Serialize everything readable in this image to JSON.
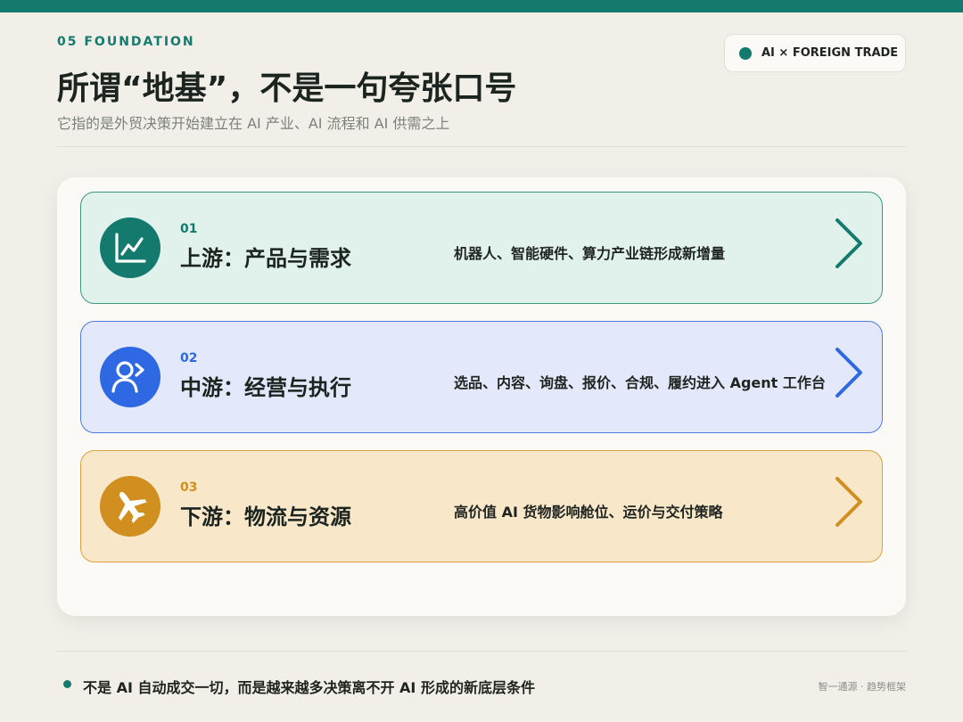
{
  "header": {
    "eyebrow": "05 FOUNDATION",
    "title": "所谓“地基”，不是一句夸张口号",
    "subtitle": "它指的是外贸决策开始建立在 AI 产业、AI 流程和 AI 供需之上",
    "tag": "AI × FOREIGN TRADE"
  },
  "rows": [
    {
      "num": "01",
      "title": "上游：产品与需求",
      "desc": "机器人、智能硬件、算力产业链形成新增量",
      "icon": "trend-chart-icon",
      "color": "#157a6e"
    },
    {
      "num": "02",
      "title": "中游：经营与执行",
      "desc": "选品、内容、询盘、报价、合规、履约进入 Agent 工作台",
      "icon": "user-agent-icon",
      "color": "#2f68e3"
    },
    {
      "num": "03",
      "title": "下游：物流与资源",
      "desc": "高价值 AI 货物影响舱位、运价与交付策略",
      "icon": "airplane-icon",
      "color": "#d08f1f"
    }
  ],
  "footer": {
    "note": "不是 AI 自动成交一切，而是越来越多决策离不开 AI 形成的新底层条件",
    "brand": "智一通源 · 趋势框架"
  }
}
